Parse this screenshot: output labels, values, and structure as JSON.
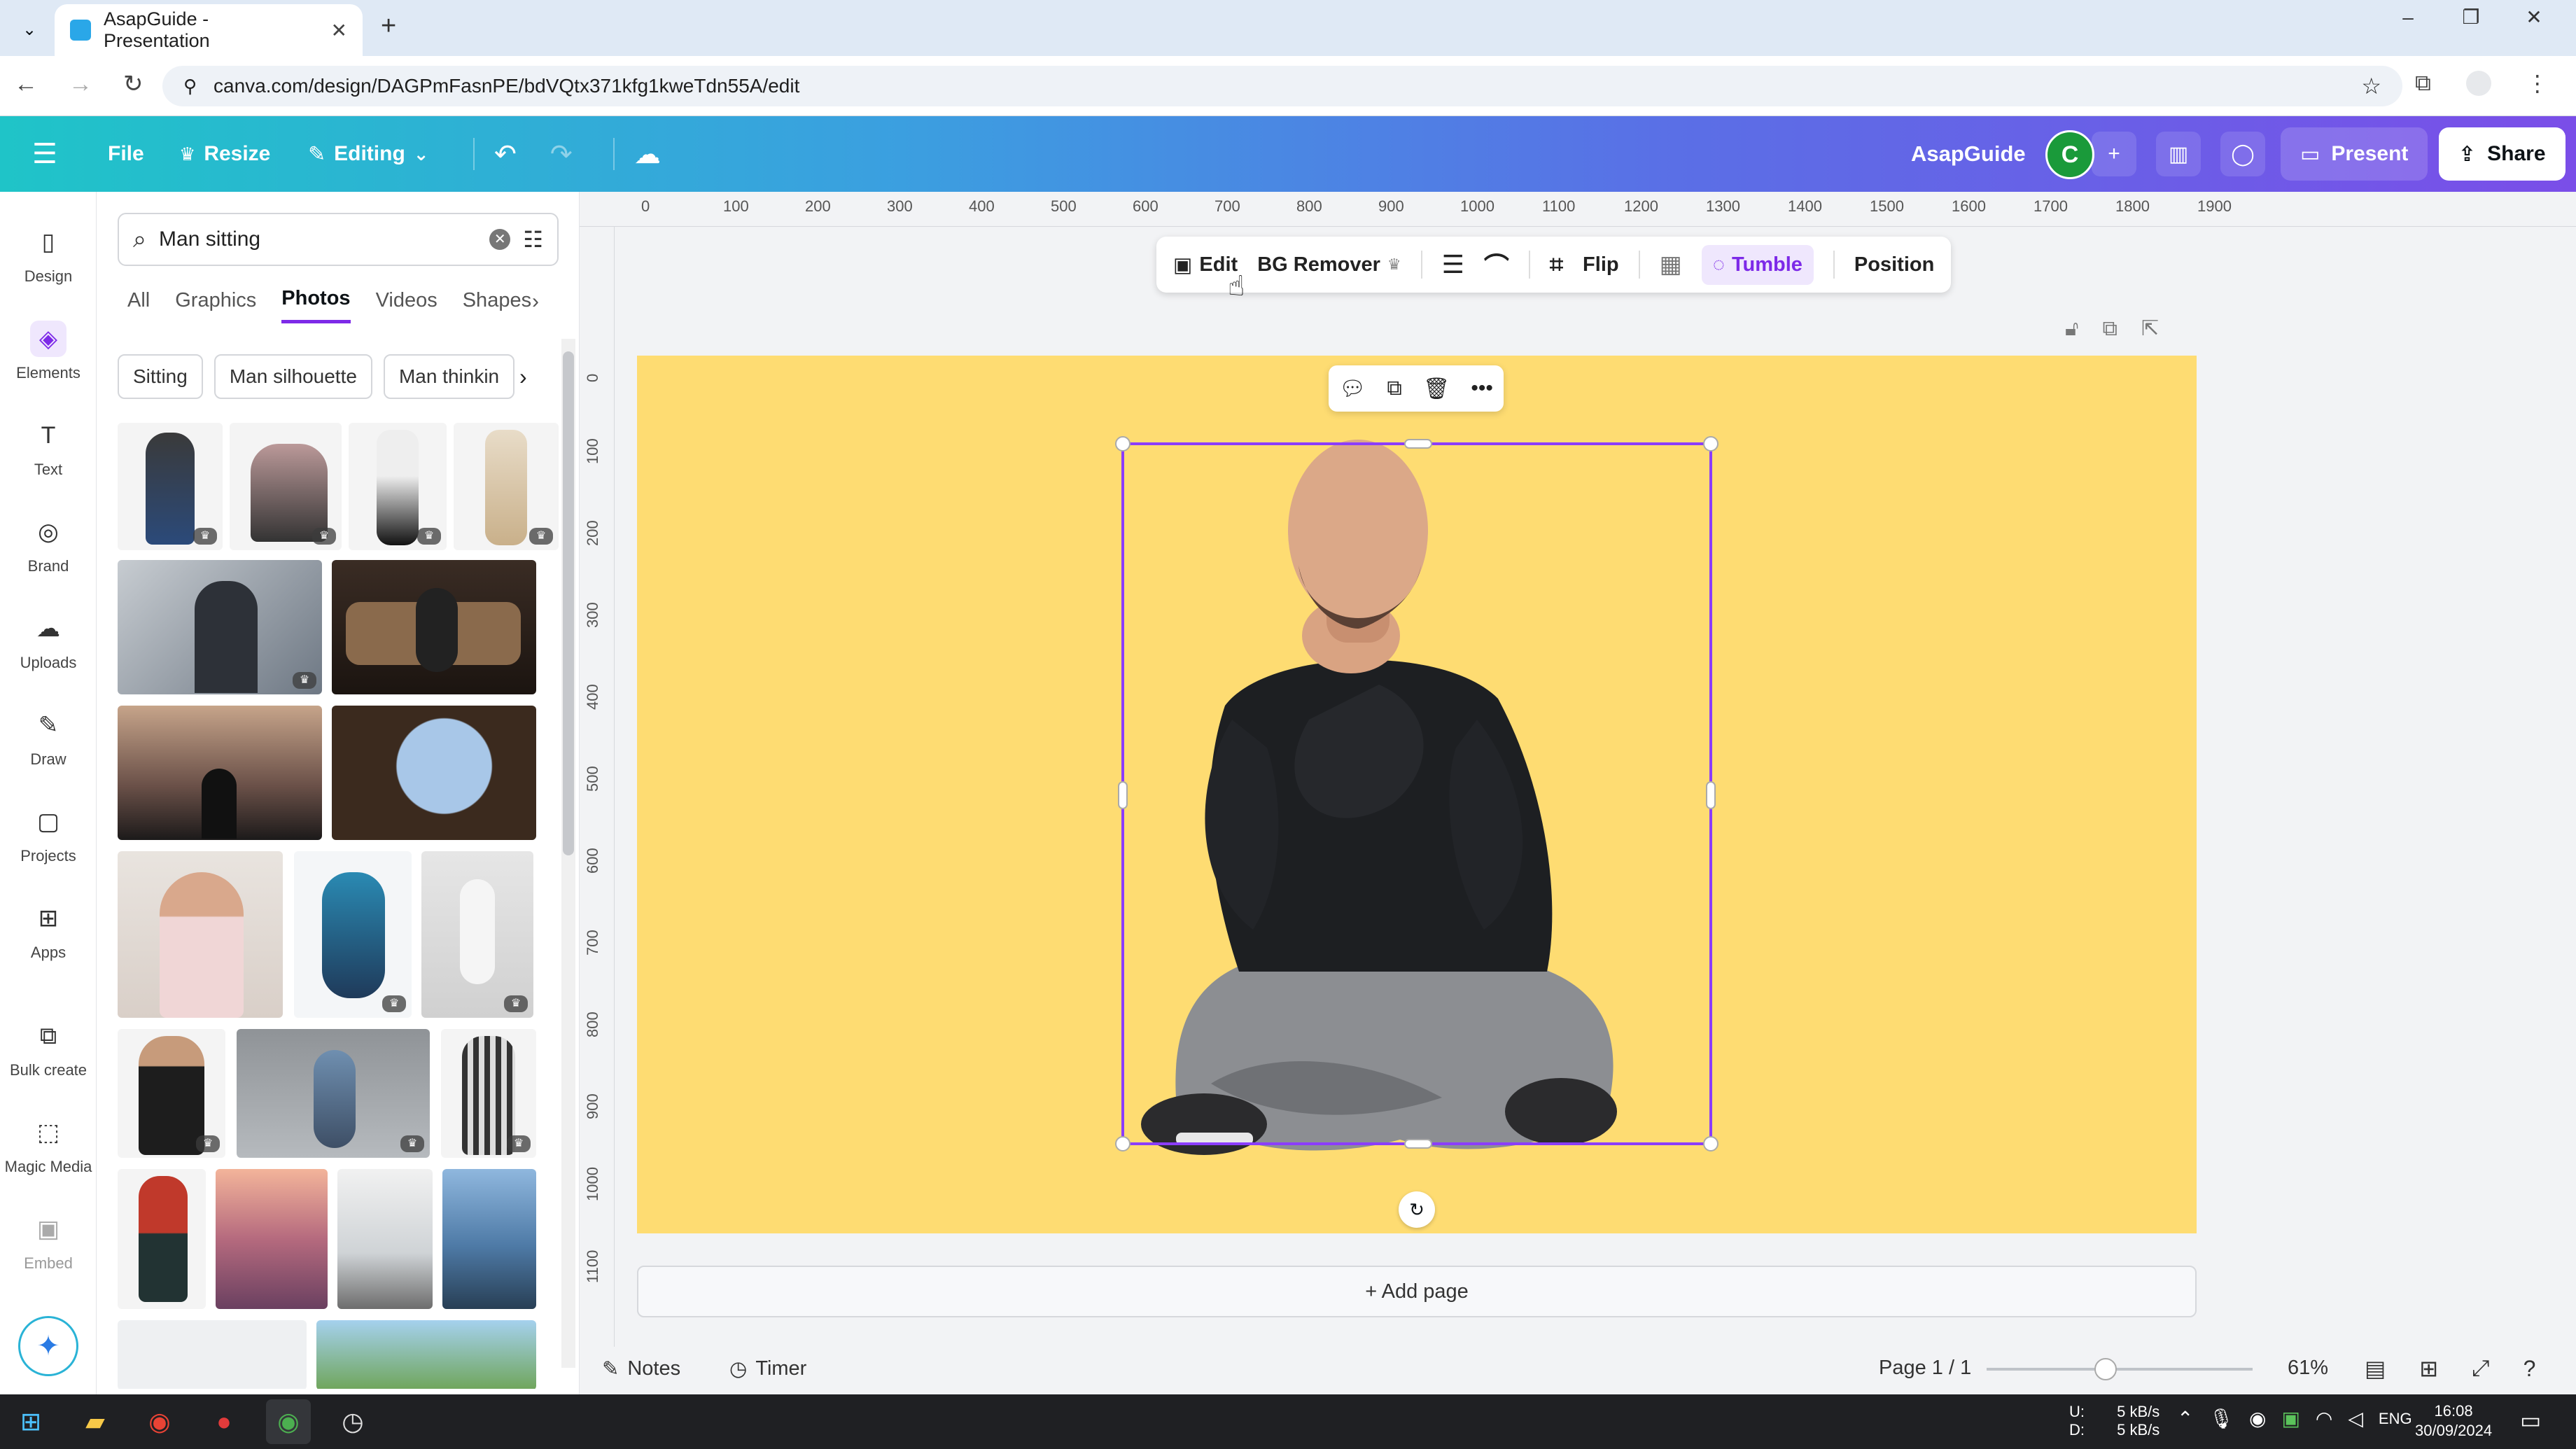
{
  "browser": {
    "tab_title": "AsapGuide - Presentation",
    "url": "canva.com/design/DAGPmFasnPE/bdVQtx371kfg1kweTdn55A/edit"
  },
  "header": {
    "menu_label": "File",
    "resize_label": "Resize",
    "mode_label": "Editing",
    "team_name": "AsapGuide",
    "avatar_initial": "C",
    "present_label": "Present",
    "share_label": "Share"
  },
  "rail": {
    "items": [
      {
        "label": "Design",
        "icon": "design-icon"
      },
      {
        "label": "Elements",
        "icon": "elements-icon"
      },
      {
        "label": "Text",
        "icon": "text-icon"
      },
      {
        "label": "Brand",
        "icon": "brand-icon"
      },
      {
        "label": "Uploads",
        "icon": "uploads-icon"
      },
      {
        "label": "Draw",
        "icon": "draw-icon"
      },
      {
        "label": "Projects",
        "icon": "projects-icon"
      },
      {
        "label": "Apps",
        "icon": "apps-icon"
      },
      {
        "label": "Bulk create",
        "icon": "bulk-create-icon"
      },
      {
        "label": "Magic Media",
        "icon": "magic-media-icon"
      },
      {
        "label": "Embed",
        "icon": "embed-icon"
      }
    ]
  },
  "panel": {
    "search_value": "Man sitting",
    "tabs": [
      "All",
      "Graphics",
      "Photos",
      "Videos",
      "Shapes"
    ],
    "active_tab": "Photos",
    "chips": [
      "Sitting",
      "Man silhouette",
      "Man thinkin"
    ]
  },
  "ruler": {
    "h_ticks": [
      "0",
      "100",
      "200",
      "300",
      "400",
      "500",
      "600",
      "700",
      "800",
      "900",
      "1000",
      "1100",
      "1200",
      "1300",
      "1400",
      "1500",
      "1600",
      "1700",
      "1800",
      "1900"
    ],
    "v_ticks": [
      "0",
      "100",
      "200",
      "300",
      "400",
      "500",
      "600",
      "700",
      "800",
      "900",
      "1000",
      "1100"
    ]
  },
  "context_toolbar": {
    "edit_label": "Edit",
    "bg_remover_label": "BG Remover",
    "flip_label": "Flip",
    "tumble_label": "Tumble",
    "position_label": "Position"
  },
  "canvas": {
    "background_color": "#fedc72",
    "add_page_label": "+ Add page"
  },
  "footer": {
    "notes_label": "Notes",
    "timer_label": "Timer",
    "page_label": "Page 1 / 1",
    "zoom_label": "61%",
    "zoom_level_percent": 61
  },
  "taskbar": {
    "net_up_label": "U:",
    "net_down_label": "D:",
    "net_up": "5 kB/s",
    "net_down": "5 kB/s",
    "lang": "ENG",
    "time": "16:08",
    "date": "30/09/2024"
  },
  "colors": {
    "accent": "#7d2ae8",
    "canvas_yellow": "#fedc72",
    "header_start": "#1fc4c8",
    "header_end": "#7a4ee8"
  }
}
